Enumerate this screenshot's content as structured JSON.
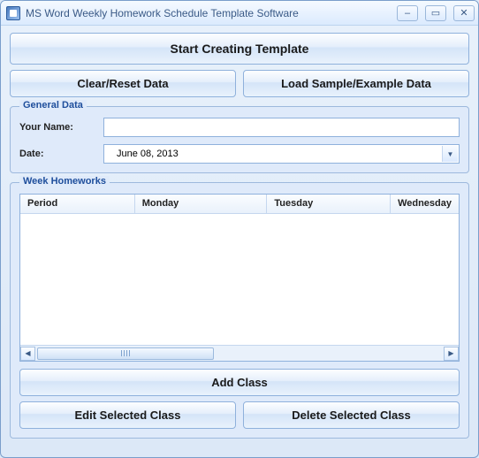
{
  "window": {
    "title": "MS Word Weekly Homework Schedule Template Software"
  },
  "buttons": {
    "start": "Start Creating Template",
    "clear": "Clear/Reset Data",
    "load": "Load Sample/Example Data",
    "add_class": "Add Class",
    "edit_class": "Edit Selected Class",
    "delete_class": "Delete Selected Class"
  },
  "general": {
    "legend": "General Data",
    "name_label": "Your Name:",
    "name_value": "",
    "date_label": "Date:",
    "date_value": "June    08, 2013"
  },
  "homeworks": {
    "legend": "Week Homeworks",
    "columns": [
      "Period",
      "Monday",
      "Tuesday",
      "Wednesday"
    ],
    "rows": []
  }
}
